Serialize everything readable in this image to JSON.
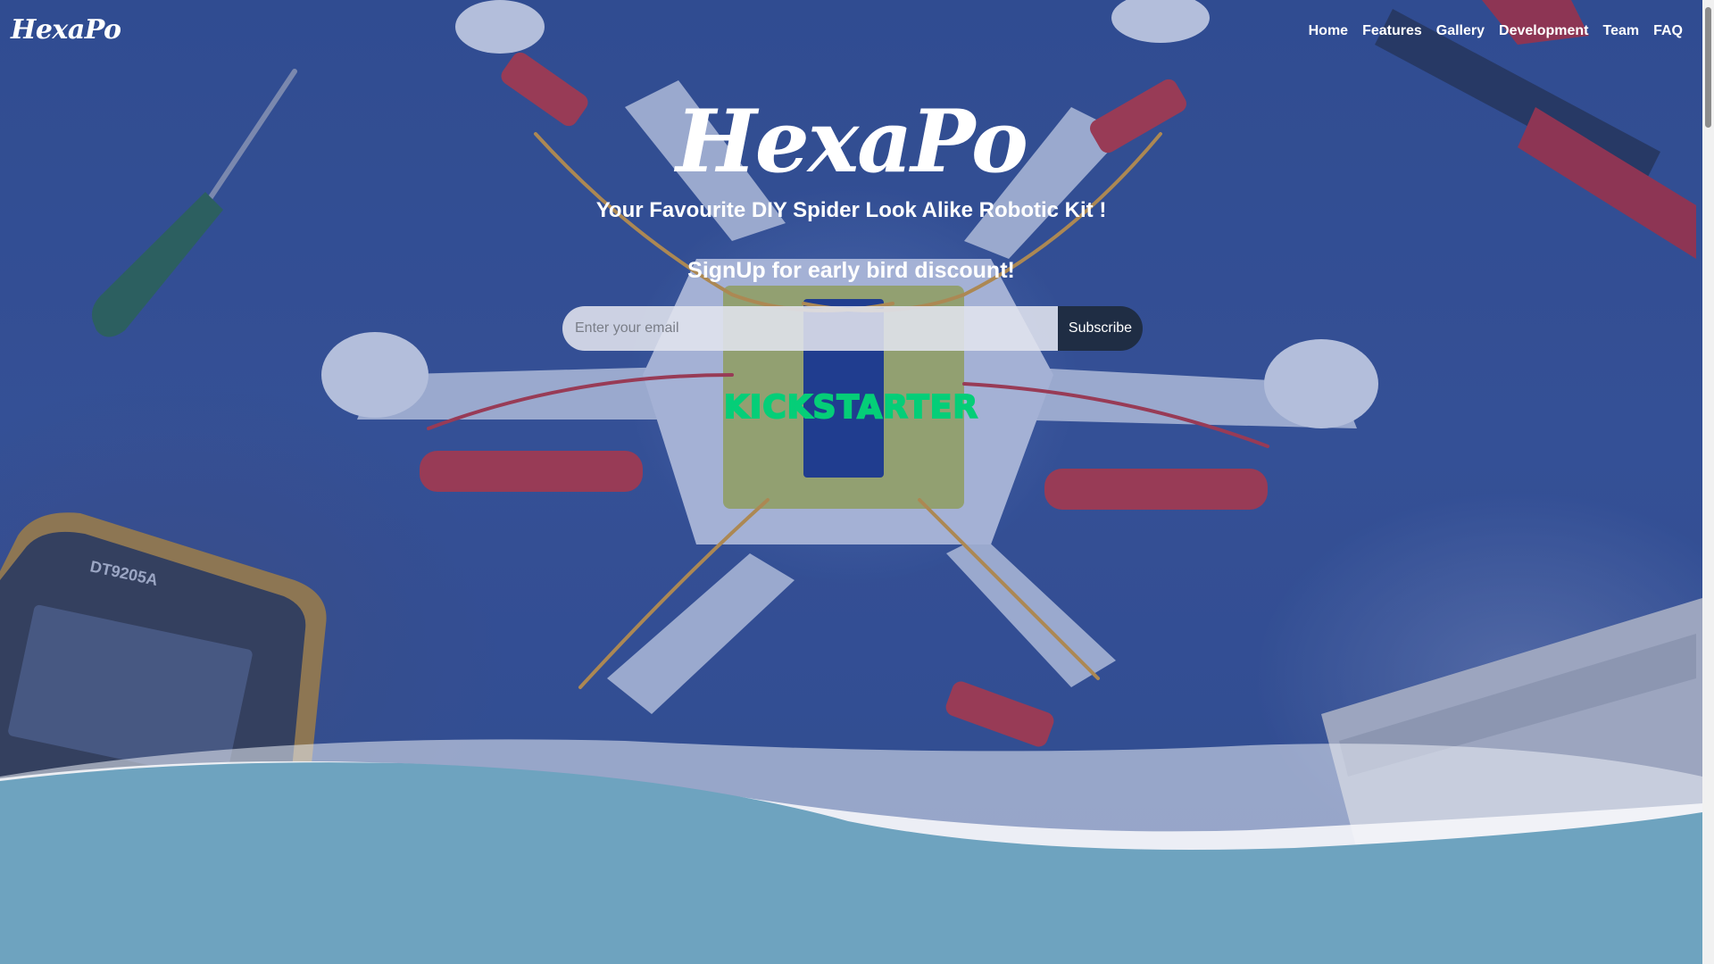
{
  "brand": "HexaPo",
  "nav": {
    "items": [
      {
        "label": "Home"
      },
      {
        "label": "Features"
      },
      {
        "label": "Gallery"
      },
      {
        "label": "Development"
      },
      {
        "label": "Team"
      },
      {
        "label": "FAQ"
      }
    ]
  },
  "hero": {
    "title": "HexaPo",
    "subtitle": "Your Favourite DIY Spider Look Alike Robotic Kit !",
    "signup_text": "SignUp for early bird discount!",
    "email_placeholder": "Enter your email",
    "subscribe_label": "Subscribe",
    "kickstarter_logo": "KICKSTARTER"
  },
  "colors": {
    "kickstarter_green": "#05ce78",
    "subscribe_button": "#1f2d44",
    "wave_blue": "#6ea3bf",
    "background_blue": "#34508f"
  }
}
